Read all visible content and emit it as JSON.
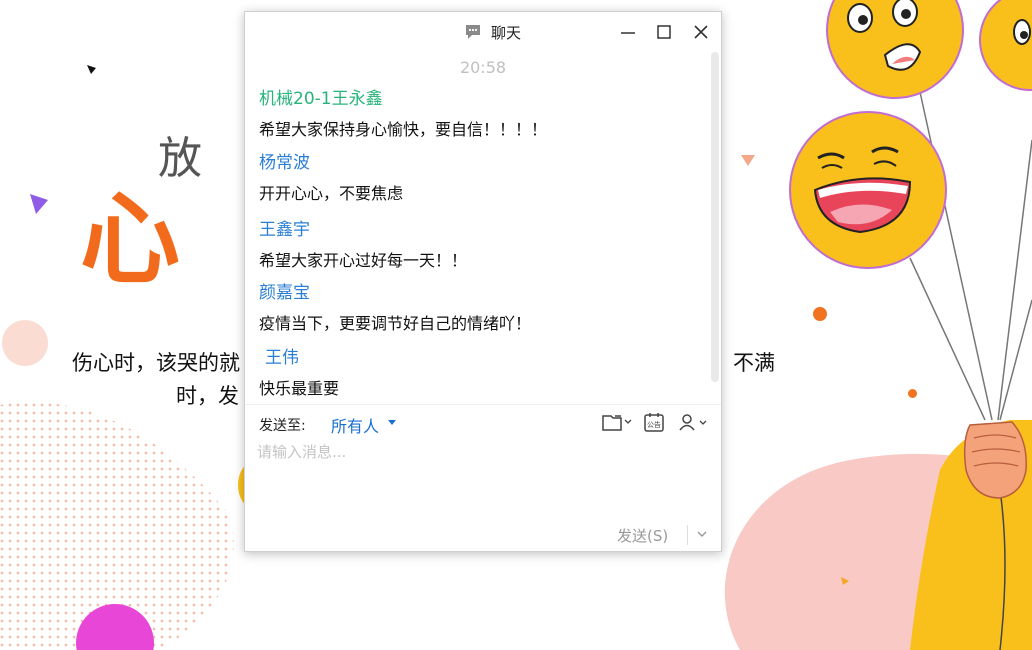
{
  "slide": {
    "heading": "放 /",
    "big_text": "心 ",
    "line1": "伤心时，该哭的就",
    "line1_right": "；不满",
    "line2": "时，发"
  },
  "chat": {
    "title": "聊天",
    "timestamp": "20:58",
    "messages": [
      {
        "sender": "机械20-1王永鑫",
        "sender_color": "#27b47a",
        "text": "希望大家保持身心愉快，要自信！！！！"
      },
      {
        "sender": "杨常波",
        "sender_color": "#2a7fd4",
        "text": "开开心心，不要焦虑"
      },
      {
        "sender": "王鑫宇",
        "sender_color": "#2a7fd4",
        "text": "希望大家开心过好每一天！！"
      },
      {
        "sender": "颜嘉宝",
        "sender_color": "#2a7fd4",
        "text": "疫情当下，更要调节好自己的情绪吖！"
      },
      {
        "sender": "王伟",
        "sender_color": "#2a7fd4",
        "text": "快乐最重要"
      }
    ],
    "compose": {
      "send_to_label": "发送至:",
      "send_to_value": "所有人",
      "placeholder": "请输入消息...",
      "send_label": "发送(S)"
    }
  },
  "icons": {
    "title": "chat-bubble-icon",
    "minimize": "minimize-icon",
    "maximize": "maximize-icon",
    "close": "close-icon",
    "folder": "folder-icon",
    "notice": "announcement-icon",
    "user": "user-icon",
    "send_more": "chevron-down-icon"
  },
  "colors": {
    "accent": "#1a6fd0",
    "slide_orange": "#f26b1d",
    "emoji_yellow": "#f9c01c"
  }
}
